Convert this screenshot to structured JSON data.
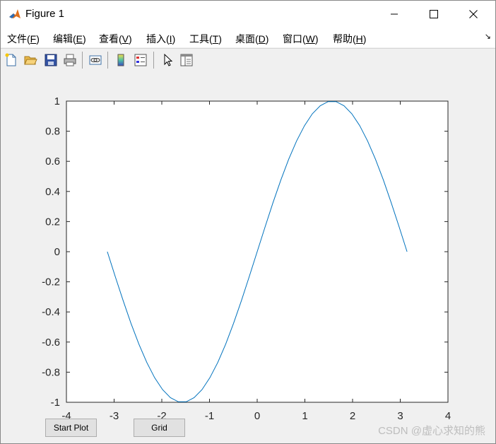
{
  "window": {
    "title": "Figure 1",
    "icon": "matlab-icon",
    "controls": [
      "minimize-icon",
      "maximize-icon",
      "close-icon"
    ]
  },
  "menu": [
    {
      "label": "文件(",
      "key": "F",
      "tail": ")"
    },
    {
      "label": "编辑(",
      "key": "E",
      "tail": ")"
    },
    {
      "label": "查看(",
      "key": "V",
      "tail": ")"
    },
    {
      "label": "插入(",
      "key": "I",
      "tail": ")"
    },
    {
      "label": "工具(",
      "key": "T",
      "tail": ")"
    },
    {
      "label": "桌面(",
      "key": "D",
      "tail": ")"
    },
    {
      "label": "窗口(",
      "key": "W",
      "tail": ")"
    },
    {
      "label": "帮助(",
      "key": "H",
      "tail": ")"
    }
  ],
  "toolbar": [
    "new-figure-icon",
    "open-folder-icon",
    "save-icon",
    "print-icon",
    "link-plot-icon",
    "colorbar-icon",
    "legend-icon",
    "pointer-icon",
    "property-inspector-icon"
  ],
  "chart_data": {
    "type": "line",
    "title": "",
    "xlabel": "",
    "ylabel": "",
    "xlim": [
      -4,
      4
    ],
    "ylim": [
      -1,
      1
    ],
    "x_ticks": [
      "-4",
      "-3",
      "-2",
      "-1",
      "0",
      "1",
      "2",
      "3",
      "4"
    ],
    "y_ticks": [
      "1",
      "0.8",
      "0.6",
      "0.4",
      "0.2",
      "0",
      "-0.2",
      "-0.4",
      "-0.6",
      "-0.8",
      "-1"
    ],
    "grid": false,
    "line_color": "#0072BD",
    "series": [
      {
        "x": [
          -3.1416,
          -2.9762,
          -2.8109,
          -2.6455,
          -2.4802,
          -2.3148,
          -2.1495,
          -1.9842,
          -1.8188,
          -1.6535,
          -1.4881,
          -1.3228,
          -1.1574,
          -0.9921,
          -0.8267,
          -0.6614,
          -0.496,
          -0.3307,
          -0.1653,
          0.0,
          0.1653,
          0.3307,
          0.496,
          0.6614,
          0.8267,
          0.9921,
          1.1574,
          1.3228,
          1.4881,
          1.6535,
          1.8188,
          1.9842,
          2.1495,
          2.3148,
          2.4802,
          2.6455,
          2.8109,
          2.9762,
          3.1416
        ],
        "y": [
          0.0,
          -0.1646,
          -0.3247,
          -0.4759,
          -0.6142,
          -0.7357,
          -0.8372,
          -0.9158,
          -0.9694,
          -0.9966,
          -0.9966,
          -0.9694,
          -0.9158,
          -0.8372,
          -0.7357,
          -0.6142,
          -0.4759,
          -0.3247,
          -0.1646,
          0.0,
          0.1646,
          0.3247,
          0.4759,
          0.6142,
          0.7357,
          0.8372,
          0.9158,
          0.9694,
          0.9966,
          0.9966,
          0.9694,
          0.9158,
          0.8372,
          0.7357,
          0.6142,
          0.4759,
          0.3247,
          0.1646,
          0.0
        ]
      }
    ]
  },
  "buttons": {
    "start_plot": "Start Plot",
    "grid": "Grid"
  },
  "watermark": "CSDN @虚心求知的熊"
}
